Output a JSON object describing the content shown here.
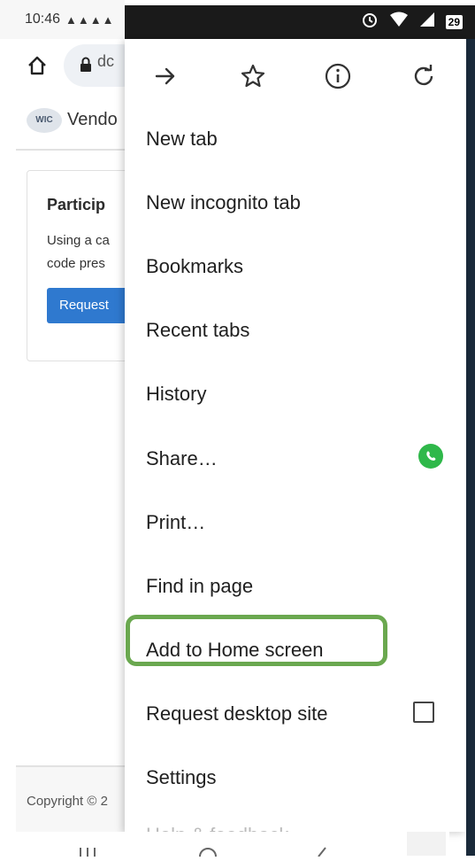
{
  "status_bar": {
    "time": "10:46",
    "notification_icons": "▲▲▲▲",
    "battery_level": "29"
  },
  "background_page": {
    "url_text": "dc",
    "site_logo_text": "WIC",
    "site_title": "Vendo",
    "card": {
      "title": "Particip",
      "text_line1": "Using a ca",
      "text_line2": "code pres",
      "button_label": "Request"
    },
    "footer_text": "Copyright © 2"
  },
  "menu": {
    "toolbar": [
      "forward-icon",
      "bookmark-star-icon",
      "info-icon",
      "refresh-icon"
    ],
    "items": [
      {
        "label": "New tab"
      },
      {
        "label": "New incognito tab"
      },
      {
        "label": "Bookmarks"
      },
      {
        "label": "Recent tabs"
      },
      {
        "label": "History"
      },
      {
        "label": "Share…"
      },
      {
        "label": "Print…"
      },
      {
        "label": "Find in page"
      },
      {
        "label": "Add to Home screen"
      },
      {
        "label": "Request desktop site"
      },
      {
        "label": "Settings"
      },
      {
        "label": "Help & feedback"
      }
    ],
    "highlight_color": "#6aa84f"
  },
  "nav_bar": {
    "icons": [
      "recents-icon",
      "home-icon",
      "back-icon"
    ]
  }
}
